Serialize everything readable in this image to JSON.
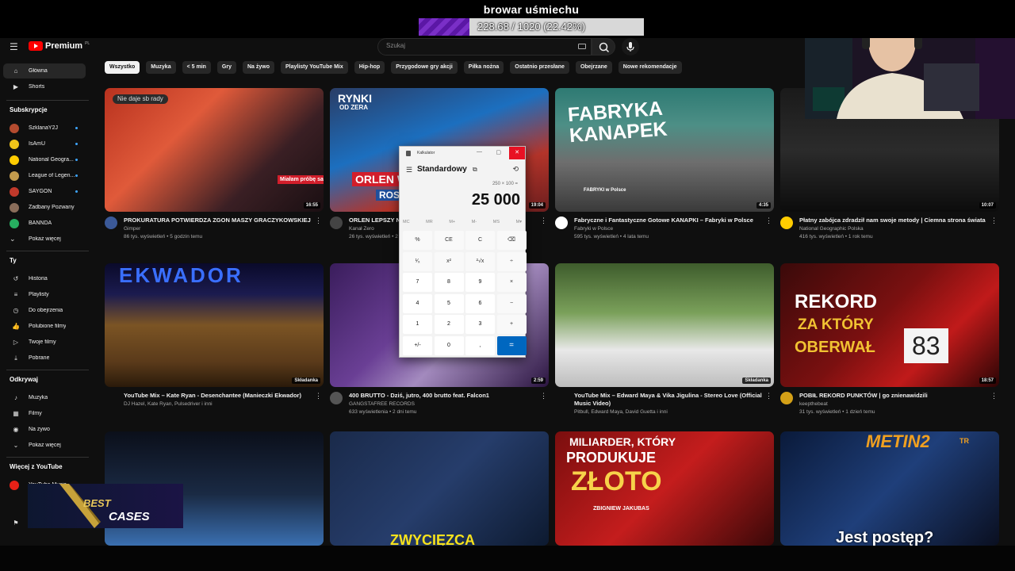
{
  "stream_goal": {
    "title": "browar uśmiechu",
    "progress_text": "228.68 / 1020 (22.42%)",
    "progress_fraction": 0.2242
  },
  "masthead": {
    "logo_text": "Premium",
    "region": "PL",
    "search_placeholder": "Szukaj"
  },
  "sidebar": {
    "main": [
      {
        "label": "Główna",
        "icon": "home-icon"
      },
      {
        "label": "Shorts",
        "icon": "shorts-icon"
      }
    ],
    "subscriptions_head": "Subskrypcje",
    "subscriptions": [
      {
        "label": "SzklanaY2J",
        "color": "#b44b2f",
        "dot": true
      },
      {
        "label": "IsAmU",
        "color": "#f0c419",
        "dot": true
      },
      {
        "label": "National Geogra...",
        "color": "#ffcc00",
        "dot": true
      },
      {
        "label": "League of Legen...",
        "color": "#c39b4d",
        "dot": true
      },
      {
        "label": "SAYGON",
        "color": "#c0392b",
        "dot": true
      },
      {
        "label": "Zadbany Pozwany",
        "color": "#8a6d5a",
        "dot": false
      },
      {
        "label": "BANNDA",
        "color": "#27ae60",
        "dot": false
      },
      {
        "label": "Pokaż więcej",
        "color": "",
        "dot": false
      }
    ],
    "you_head": "Ty",
    "you": [
      {
        "label": "Historia",
        "icon": "history-icon"
      },
      {
        "label": "Playlisty",
        "icon": "playlist-icon"
      },
      {
        "label": "Do obejrzenia",
        "icon": "watch-later-icon"
      },
      {
        "label": "Polubione filmy",
        "icon": "like-icon"
      },
      {
        "label": "Twoje filmy",
        "icon": "video-icon"
      },
      {
        "label": "Pobrane",
        "icon": "download-icon"
      }
    ],
    "explore_head": "Odkrywaj",
    "explore": [
      {
        "label": "Muzyka",
        "icon": "music-icon"
      },
      {
        "label": "Filmy",
        "icon": "film-icon"
      },
      {
        "label": "Na żywo",
        "icon": "live-icon"
      },
      {
        "label": "Pokaż więcej",
        "icon": "chevron-down-icon"
      }
    ],
    "more_head": "Więcej z YouTube",
    "more": [
      {
        "label": "YouTube Music"
      }
    ]
  },
  "chips": [
    "Wszystko",
    "Muzyka",
    "< 5 min",
    "Gry",
    "Na żywo",
    "Playlisty YouTube Mix",
    "Hip-hop",
    "Przygodowe gry akcji",
    "Piłka nożna",
    "Ostatnio przesłane",
    "Obejrzane",
    "Nowe rekomendacje"
  ],
  "videos": [
    {
      "title": "PROKURATURA POTWIERDZA ZGON MASZY GRACZYKOWSKIEJ",
      "channel": "Gimper",
      "meta": "86 tys. wyświetleń • 5 godzin temu",
      "duration": "16:55",
      "avatar_color": "#3b5998",
      "bg": "linear-gradient(135deg,#b8321f 0%,#e05a3a 35%,#3a1f24 70%,#1a0f12 100%)"
    },
    {
      "title": "ORLEN LEPSZY NIŻ... \"THE TELEGRAPH\"",
      "channel": "Kanał Zero",
      "meta": "26 tys. wyświetleń • 2 godziny temu",
      "duration": "19:04",
      "avatar_color": "#444",
      "bg": "linear-gradient(160deg,#2a3d66 0%,#1c6fbf 40%,#b3342a 70%,#6b1e1e 100%)"
    },
    {
      "title": "Fabryczne i Fantastyczne Gotowe KANAPKI – Fabryki w Polsce",
      "channel": "Fabryki w Polsce",
      "meta": "595 tys. wyświetleń • 4 lata temu",
      "duration": "4:35",
      "avatar_color": "#fff",
      "bg": "linear-gradient(180deg,#2e7a73 0%,#4d8f86 30%,#6e6e6e 60%,#3a3a3a 100%)"
    },
    {
      "title": "Płatny zabójca zdradził nam swoje metody | Ciemna strona świata",
      "channel": "National Geographic Polska",
      "meta": "416 tys. wyświetleń • 1 rok temu",
      "duration": "10:07",
      "avatar_color": "#ffcc00",
      "bg": "linear-gradient(180deg,#1a1a1a 0%,#2b2b2b 50%,#0c0c0c 100%)"
    },
    {
      "title": "YouTube Mix – Kate Ryan - Desenchantee (Manieczki Ekwador)",
      "channel": "DJ Hazel, Kate Ryan, Pulsedriver i inni",
      "meta": "",
      "duration": "Składanka",
      "avatar_color": "",
      "bg": "linear-gradient(180deg,#0a0a2a 0%,#1b1b4f 25%,#7b5424 50%,#5a3a1a 80%,#2a1a0a 100%)"
    },
    {
      "title": "400 BRUTTO - Dziś, jutro, 400 brutto feat. Falcon1",
      "channel": "GANGSTAFREE RECORDS",
      "meta": "633 wyświetlenia • 2 dni temu",
      "duration": "2:59",
      "avatar_color": "#555",
      "bg": "linear-gradient(135deg,#3a1d5c 0%,#6a3f95 40%,#a48bbf 60%,#2b1540 100%)"
    },
    {
      "title": "YouTube Mix – Edward Maya & Vika Jigulina - Stereo Love (Official Music Video)",
      "channel": "Pitbull, Edward Maya, David Guetta i inni",
      "meta": "",
      "duration": "Składanka",
      "avatar_color": "",
      "bg": "linear-gradient(180deg,#3e5c2c 0%,#7aa05a 40%,#e8e8e8 70%,#bdbdbd 100%)"
    },
    {
      "title": "POBIŁ REKORD PUNKTÓW | go znienawidzili",
      "channel": "keepthebeat",
      "meta": "31 tys. wyświetleń • 1 dzień temu",
      "duration": "18:57",
      "avatar_color": "#d4a017",
      "bg": "linear-gradient(135deg,#3a0a0a 0%,#7a1010 45%,#c01a1a 70%,#2a0505 100%)"
    },
    {
      "title": "",
      "channel": "",
      "meta": "",
      "duration": "",
      "avatar_color": "",
      "bg": "linear-gradient(180deg,#0b0f1a 0%,#1a2a44 55%,#3a6fb0 100%)"
    },
    {
      "title": "",
      "channel": "",
      "meta": "",
      "duration": "",
      "avatar_color": "",
      "bg": "linear-gradient(135deg,#1a2a4a 0%,#263d6b 50%,#0d1a30 100%)"
    },
    {
      "title": "",
      "channel": "",
      "meta": "",
      "duration": "",
      "avatar_color": "",
      "bg": "linear-gradient(135deg,#7a0e0e 0%,#c41d1d 50%,#3a0808 100%)"
    },
    {
      "title": "",
      "channel": "",
      "meta": "",
      "duration": "",
      "avatar_color": "",
      "bg": "linear-gradient(135deg,#0a1a3a 0%,#1f3f7a 50%,#0a0f20 100%)"
    }
  ],
  "overlays": {
    "t1_badge": "Nie daje sb rady",
    "t1_caption": "Miałam próbę samobójczą",
    "t2_top": "RYNKI",
    "t2_sub": "OD ZERA",
    "t2_word": "ORLEN W",
    "t2_word2": "ROSY",
    "t3_line1": "FABRYKA",
    "t3_line2": "KANAPEK",
    "t3_brand": "FABRYKI w Polsce",
    "t5_sign": "EKWADOR",
    "t8_line1": "REKORD",
    "t8_line2": "ZA KTÓRY",
    "t8_line3": "OBERWAŁ",
    "t8_sign": "83",
    "t11_line1": "MILIARDER, KTÓRY",
    "t11_line2": "PRODUKUJE",
    "t11_line3": "ZŁOTO",
    "t11_name": "ZBIGNIEW JAKUBAS",
    "t10_word": "ZWYCIĘZCA",
    "t12_logo": "METIN2",
    "t12_logo_sup": "TR",
    "t12_caption": "Jest postęp?",
    "cases_text": "CASES",
    "cases_prefix": "BEST"
  },
  "calculator": {
    "title": "Kalkulator",
    "mode": "Standardowy",
    "expression": "250 × 100 =",
    "display": "25 000",
    "memory": [
      "MC",
      "MR",
      "M+",
      "M-",
      "MS",
      "M▾"
    ],
    "buttons": [
      [
        "%",
        "CE",
        "C",
        "⌫"
      ],
      [
        "¹⁄ₓ",
        "x²",
        "²√x",
        "÷"
      ],
      [
        "7",
        "8",
        "9",
        "×"
      ],
      [
        "4",
        "5",
        "6",
        "−"
      ],
      [
        "1",
        "2",
        "3",
        "+"
      ],
      [
        "+/-",
        "0",
        ",",
        "="
      ]
    ]
  }
}
